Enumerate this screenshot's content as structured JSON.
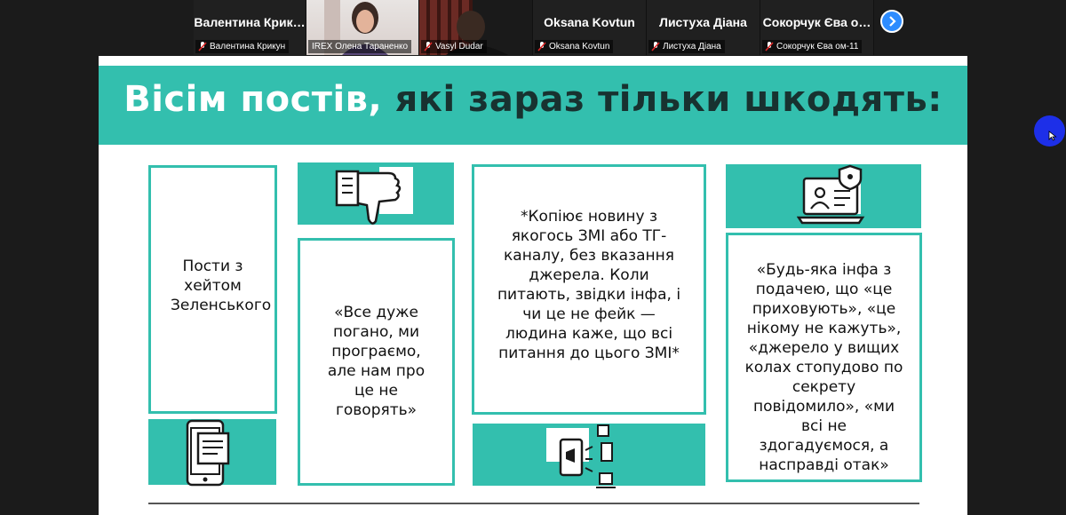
{
  "participants": [
    {
      "tile_name": "Валентина  Крик…",
      "label": "Валентина Крикун"
    },
    {
      "tile_name": "",
      "label": "IREX Олена Тараненко"
    },
    {
      "tile_name": "",
      "label": "Vasyl Dudar"
    },
    {
      "tile_name": "Oksana Kovtun",
      "label": "Oksana Kovtun"
    },
    {
      "tile_name": "Листуха Діана",
      "label": "Листуха Діана"
    },
    {
      "tile_name": "Сокорчук Єва о…",
      "label": "Сокорчук Єва ом-11"
    }
  ],
  "slide": {
    "title_white": "Вісім постів,",
    "title_dark": "які зараз тільки шкодять:",
    "box1": "Пости з хейтом Зеленського",
    "box2": "«Все дуже погано, ми програємо, але нам про це не говорять»",
    "box3": "*Копіює новину з якогось ЗМІ або ТГ-каналу, без вказання джерела. Коли питають, звідки інфа, і чи це не фейк — людина каже, що всі питання до цього ЗМІ*",
    "box4": "«Будь-яка інфа з подачею, що «це приховують», «це нікому не кажуть», «джерело у вищих колах стопудово по секрету повідомило», «ми всі не здогадуємося, а насправді отак»"
  },
  "colors": {
    "teal": "#33bfae",
    "dark_text": "#183230",
    "zoom_blue": "#2d8cff"
  },
  "icons": [
    "muted-mic-icon",
    "next-page-icon",
    "thumbs-down-icon",
    "tablet-document-icon",
    "laptop-user-shield-icon",
    "phone-megaphone-icon"
  ]
}
